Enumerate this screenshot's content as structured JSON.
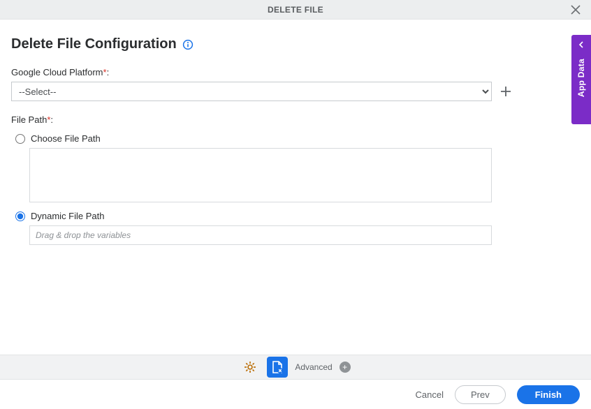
{
  "header": {
    "title": "DELETE FILE"
  },
  "page": {
    "title": "Delete File Configuration"
  },
  "fields": {
    "gcp": {
      "label": "Google Cloud Platform",
      "selected": "--Select--"
    },
    "file_path": {
      "label": "File Path",
      "choose_label": "Choose File Path",
      "dynamic_label": "Dynamic File Path",
      "dynamic_placeholder": "Drag & drop the variables"
    }
  },
  "side_tab": {
    "label": "App Data"
  },
  "toolbar": {
    "advanced_label": "Advanced"
  },
  "footer": {
    "cancel": "Cancel",
    "prev": "Prev",
    "finish": "Finish"
  }
}
